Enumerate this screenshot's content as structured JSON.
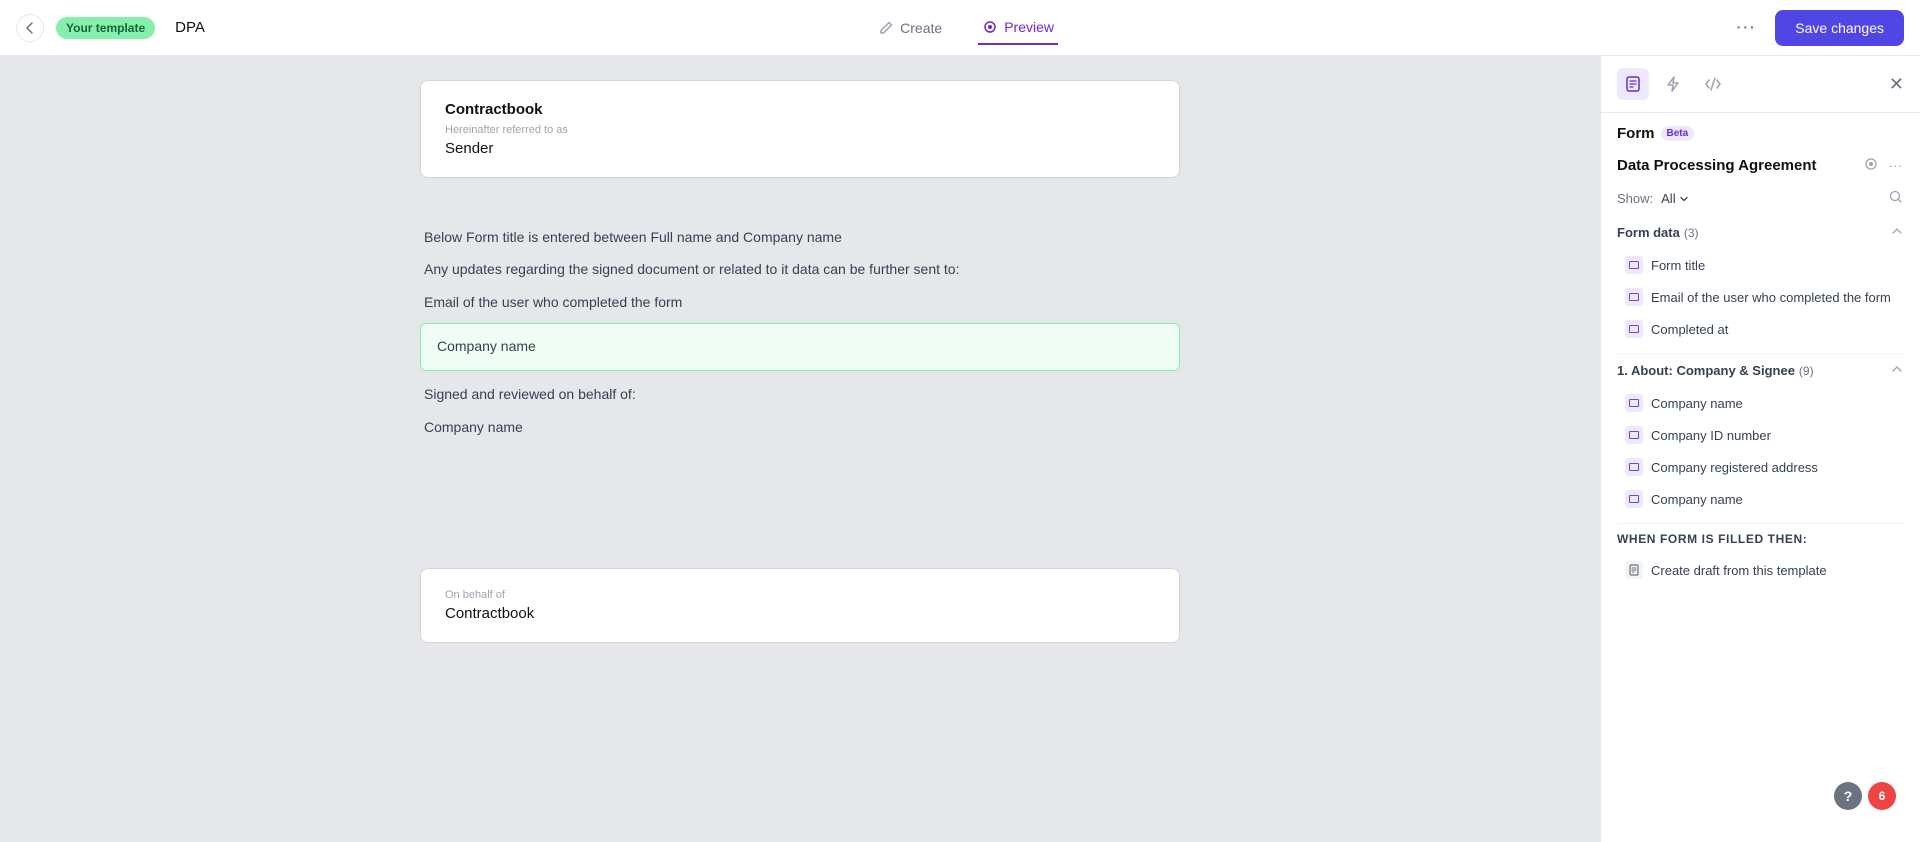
{
  "topbar": {
    "back_label": "←",
    "template_badge": "Your template",
    "doc_title": "DPA",
    "nav_create": "Create",
    "nav_preview": "Preview",
    "more_label": "···",
    "save_label": "Save changes"
  },
  "document": {
    "card1": {
      "label": "",
      "company": "Contractbook",
      "referred_label": "Hereinafter referred to as",
      "referred_value": "Sender"
    },
    "text1": "Below Form title is entered between  Full name and Company name",
    "text2": "Any updates regarding the signed document or related to it data can be further sent to:",
    "text3": "Email of the user who completed the form",
    "highlighted_text": "Company name",
    "text4": "Signed and reviewed on behalf of:",
    "text5": "Company name",
    "card2": {
      "label": "On behalf of",
      "value": "Contractbook"
    }
  },
  "sidebar": {
    "form_label": "Form",
    "beta_label": "Beta",
    "doc_name": "Data Processing Agreement",
    "show_label": "Show:",
    "show_value": "All",
    "form_data_label": "Form data",
    "form_data_count": "(3)",
    "section1_label": "1. About: Company & Signee",
    "section1_count": "(9)",
    "fields": {
      "form_title": "Form title",
      "email_completed": "Email of the user who completed the form",
      "completed_at": "Completed at",
      "company_name": "Company name",
      "company_id": "Company ID number",
      "company_address": "Company registered address",
      "company_name2": "Company name"
    },
    "when_filled_label": "When form is filled then:",
    "create_draft_label": "Create draft from this template"
  },
  "badges": {
    "notif_count": "6",
    "help_label": "?"
  }
}
